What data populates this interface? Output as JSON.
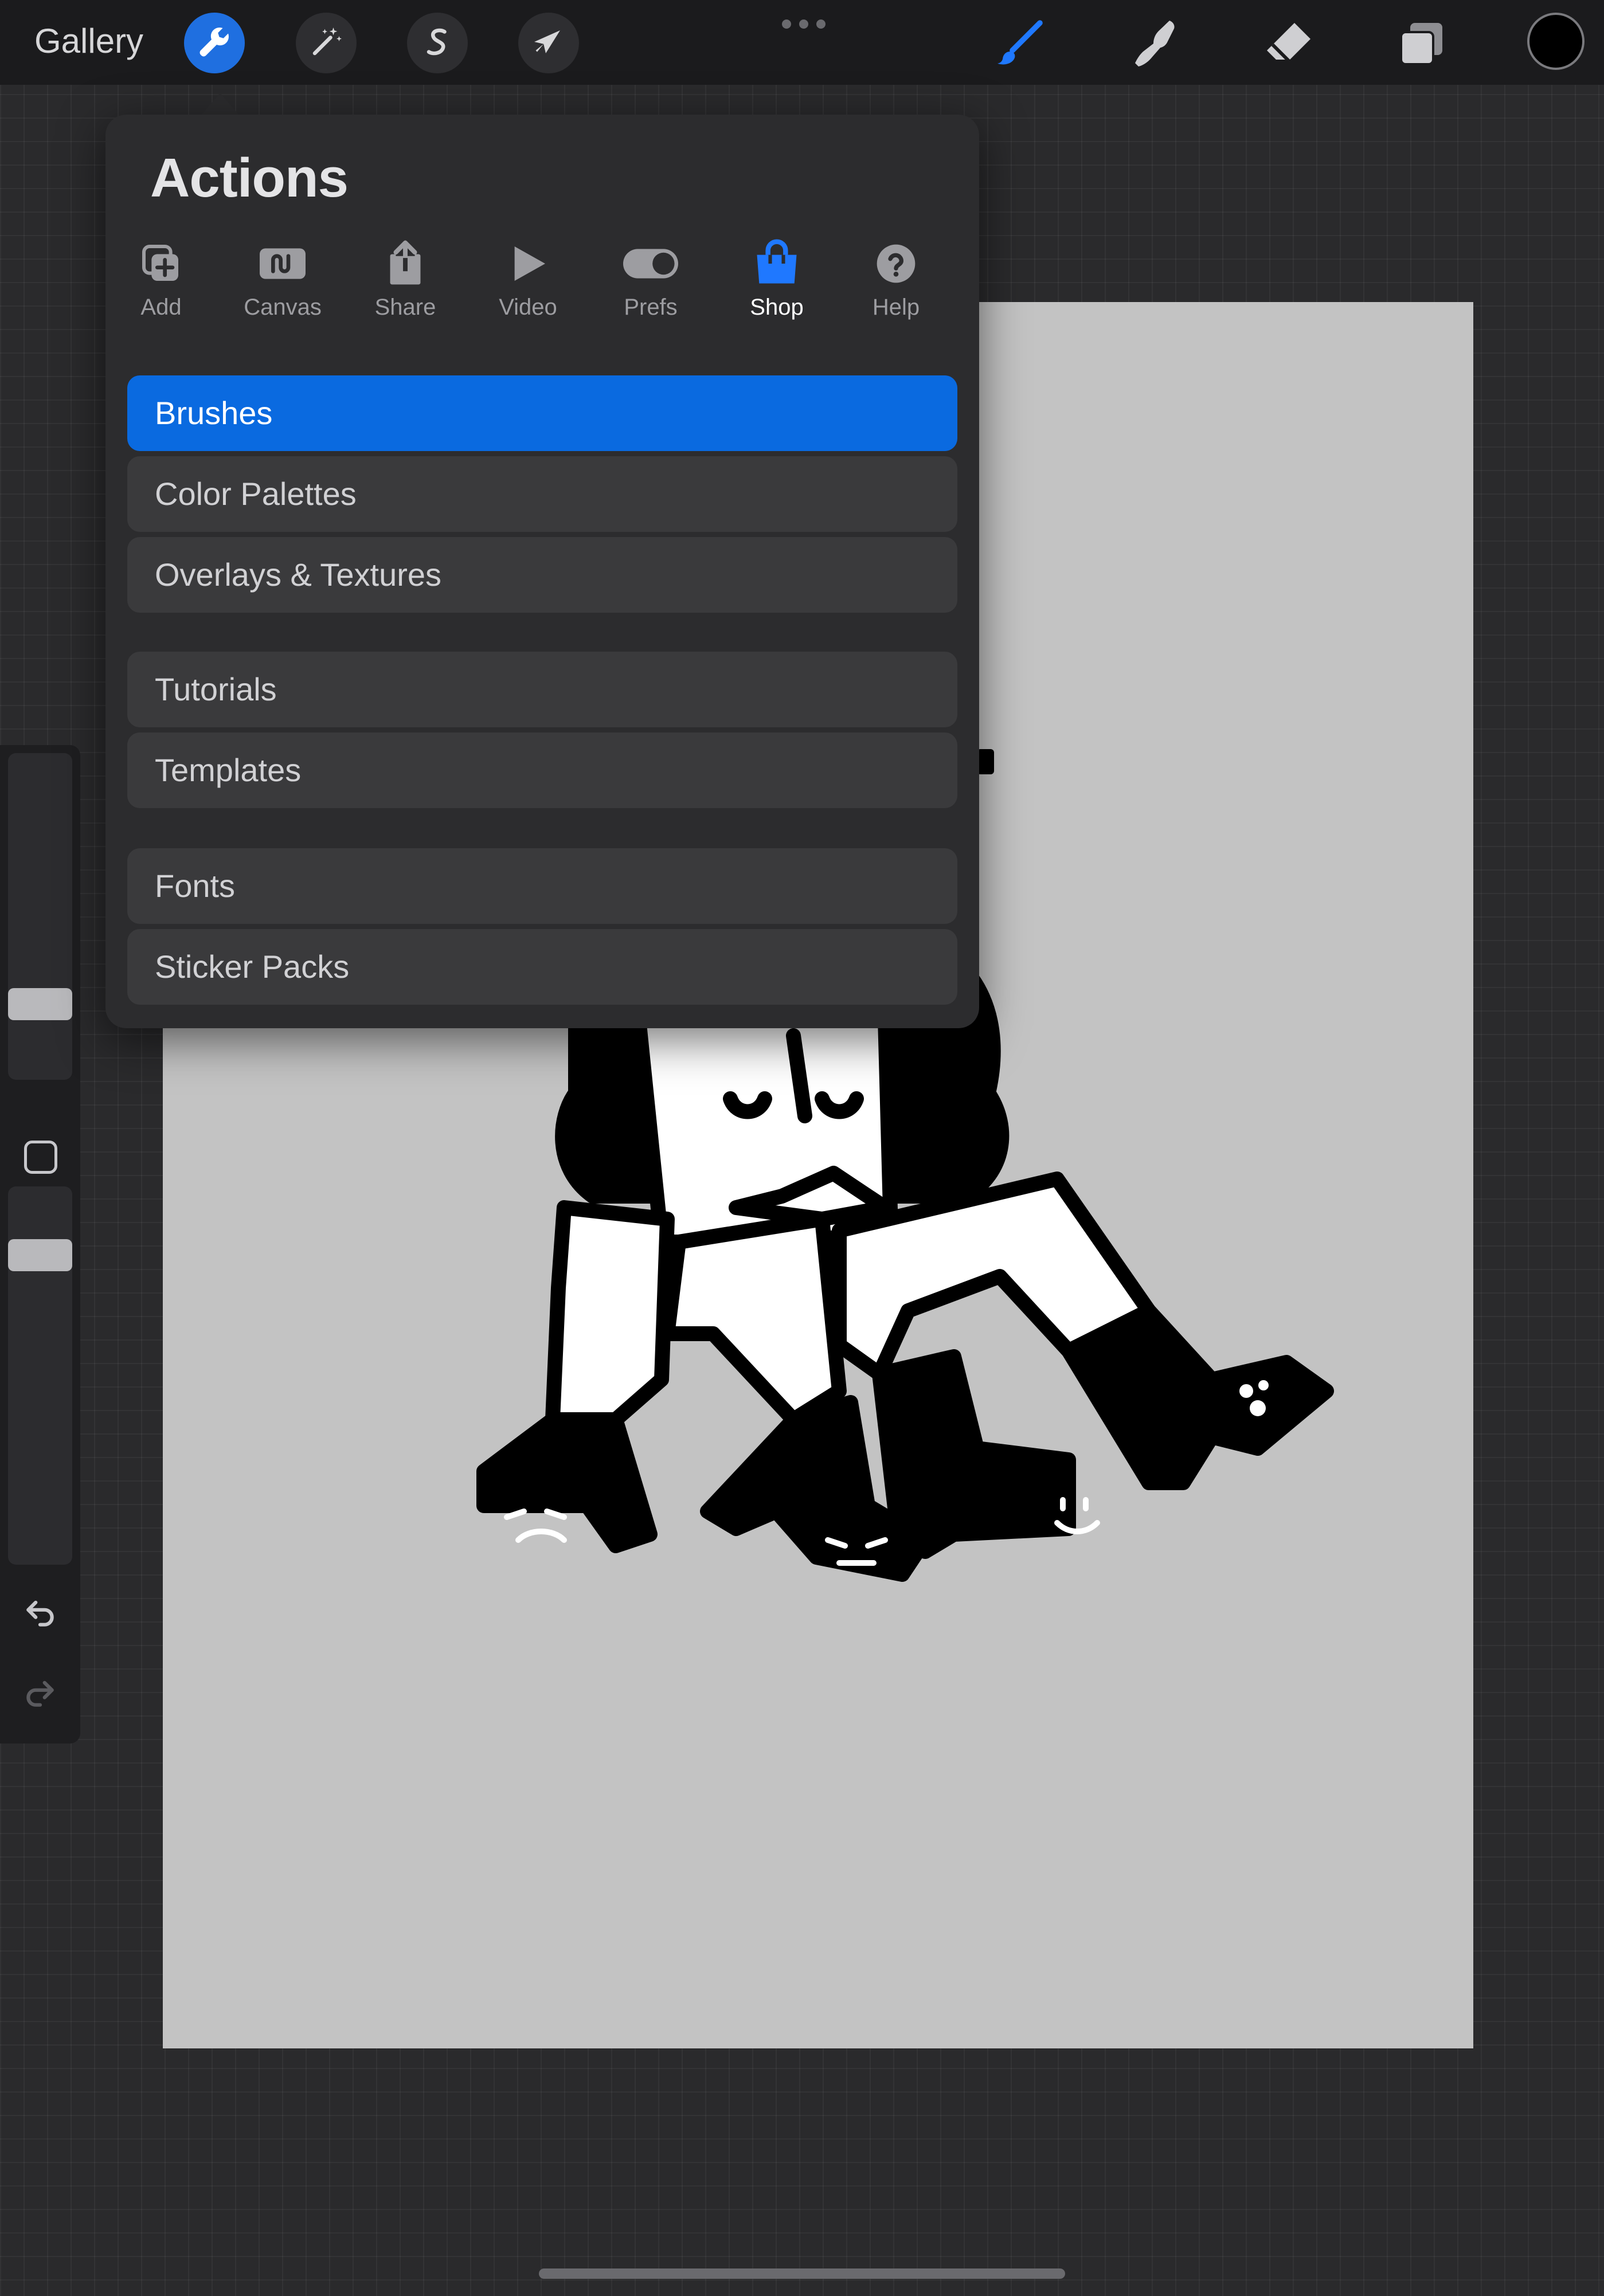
{
  "topbar": {
    "gallery_label": "Gallery",
    "tools_left": [
      {
        "name": "actions",
        "icon": "wrench-icon",
        "active": true
      },
      {
        "name": "adjustments",
        "icon": "magic-wand-icon",
        "active": false
      },
      {
        "name": "selection",
        "icon": "selection-s-icon",
        "active": false
      },
      {
        "name": "transform",
        "icon": "arrow-cursor-icon",
        "active": false
      }
    ],
    "tools_right": [
      {
        "name": "brush",
        "icon": "brush-icon",
        "active": true
      },
      {
        "name": "smudge",
        "icon": "smudge-finger-icon",
        "active": false
      },
      {
        "name": "eraser",
        "icon": "eraser-icon",
        "active": false
      },
      {
        "name": "layers",
        "icon": "layers-icon",
        "active": false
      }
    ],
    "current_color": "#000000"
  },
  "actions_popover": {
    "title": "Actions",
    "tabs": [
      {
        "label": "Add",
        "icon": "add-plus-icon",
        "active": false
      },
      {
        "label": "Canvas",
        "icon": "canvas-wave-icon",
        "active": false
      },
      {
        "label": "Share",
        "icon": "share-arrow-icon",
        "active": false
      },
      {
        "label": "Video",
        "icon": "play-icon",
        "active": false
      },
      {
        "label": "Prefs",
        "icon": "toggle-icon",
        "active": false
      },
      {
        "label": "Shop",
        "icon": "shopping-bag-icon",
        "active": true
      },
      {
        "label": "Help",
        "icon": "question-icon",
        "active": false
      }
    ],
    "menu_items": [
      {
        "label": "Brushes",
        "selected": true
      },
      {
        "label": "Color Palettes",
        "selected": false
      },
      {
        "label": "Overlays & Textures",
        "selected": false
      },
      {
        "label": "Tutorials",
        "selected": false
      },
      {
        "label": "Templates",
        "selected": false
      },
      {
        "label": "Fonts",
        "selected": false
      },
      {
        "label": "Sticker Packs",
        "selected": false
      }
    ]
  },
  "sidebar": {
    "controls": [
      "brush-size-slider",
      "modify-button",
      "opacity-slider",
      "undo-icon",
      "redo-icon"
    ]
  },
  "colors": {
    "accent": "#0a6ae0",
    "canvas": "#c3c3c3",
    "background": "#2a2a2c"
  }
}
